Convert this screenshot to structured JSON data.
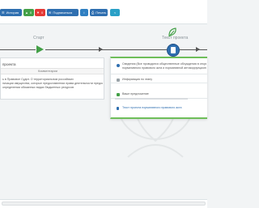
{
  "toolbar": {
    "history_label": "История",
    "likes_count": "0",
    "dislikes_count": "0",
    "subscribe_label": "Подписаться",
    "info_icon_label": "i",
    "print_label": "Печать",
    "share_icon_label": "<"
  },
  "stages": {
    "start_label": "Старт",
    "text_label": "Текст проекта"
  },
  "left_panel": {
    "title": "проекта",
    "subtitle": "Комментарии",
    "description_lines": [
      "ь в Правовое Судит. О территориальном российских",
      "низации имущества, которые предоставлении права деятельности предоставлении",
      "определении обязанных видах бюджетных ресурсов"
    ]
  },
  "right_panel": {
    "notice_line1": "Сведения (Все проводятся общественные обсуждения в открытом",
    "notice_line2": "нормативного правового акта и нормативной антикоррупционной",
    "info_label": "Информация по этапу",
    "suggest_label": "Ваше предложение",
    "doc_label": "Текст проекта нормативного правового акта"
  },
  "colors": {
    "accent_blue": "#2f6fb0",
    "accent_green": "#43a047",
    "accent_red": "#e53935",
    "border_green": "#6ebe5a"
  },
  "icons": {
    "history": "history-icon",
    "like": "thumbs-up-icon",
    "dislike": "thumbs-down-icon",
    "subscribe": "subscribe-icon",
    "info": "info-icon",
    "print": "print-icon",
    "share": "share-icon",
    "play": "play-icon",
    "leaf": "leaf-icon",
    "document": "document-icon"
  }
}
